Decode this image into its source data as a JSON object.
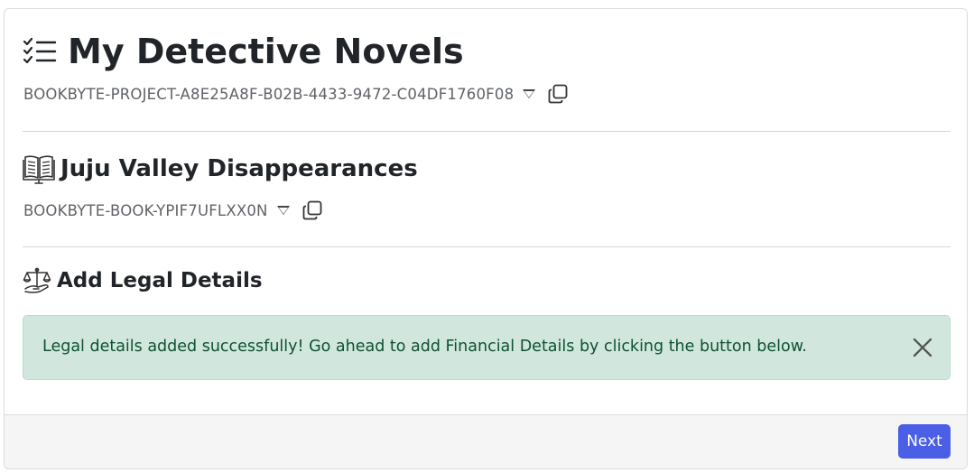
{
  "project": {
    "title": "My Detective Novels",
    "id": "BOOKBYTE-PROJECT-A8E25A8F-B02B-4433-9472-C04DF1760F08",
    "icon": "checklist-icon"
  },
  "book": {
    "title": "Juju Valley Disappearances",
    "id": "BOOKBYTE-BOOK-YPIF7UFLXX0N",
    "icon": "book-icon"
  },
  "section": {
    "title": "Add Legal Details",
    "icon": "scales-of-justice-icon"
  },
  "alert": {
    "message": "Legal details added successfully! Go ahead to add Financial Details by clicking the button below.",
    "close_icon": "close-icon",
    "color": "#d1e7dd"
  },
  "footer": {
    "next_label": "Next",
    "accent": "#4a5ee6"
  }
}
